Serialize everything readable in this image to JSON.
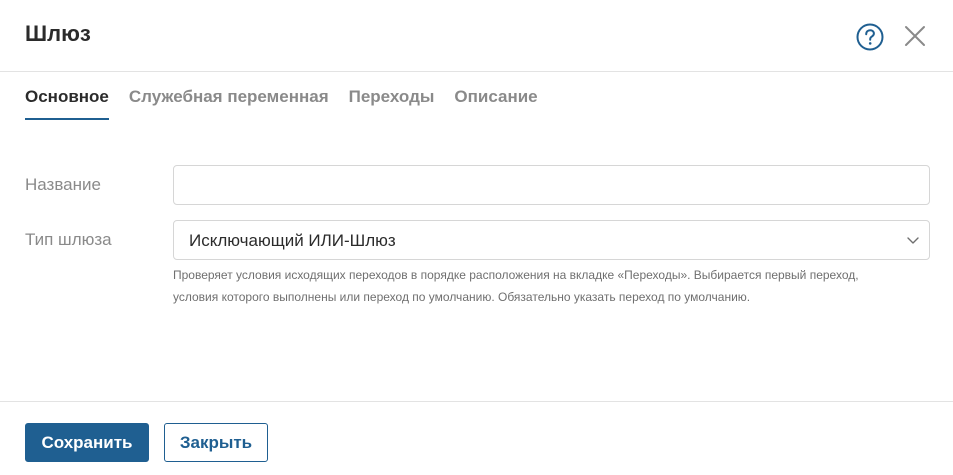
{
  "dialog": {
    "title": "Шлюз",
    "help_icon": "question-circle-icon",
    "close_icon": "close-icon"
  },
  "tabs": [
    {
      "label": "Основное",
      "active": true
    },
    {
      "label": "Служебная переменная",
      "active": false
    },
    {
      "label": "Переходы",
      "active": false
    },
    {
      "label": "Описание",
      "active": false
    }
  ],
  "form": {
    "name": {
      "label": "Название",
      "value": ""
    },
    "gateway_type": {
      "label": "Тип шлюза",
      "value": "Исключающий ИЛИ-Шлюз",
      "hint_line1": "Проверяет условия исходящих переходов в порядке расположения на вкладке «Переходы». Выбирается первый переход,",
      "hint_line2": "условия которого выполнены или переход по умолчанию. Обязательно указать переход по умолчанию."
    }
  },
  "footer": {
    "save_label": "Сохранить",
    "close_label": "Закрыть"
  },
  "colors": {
    "accent": "#1f5f91",
    "text": "#2b2b2b",
    "muted": "#8a8a8a",
    "border": "#d6d6d6"
  }
}
